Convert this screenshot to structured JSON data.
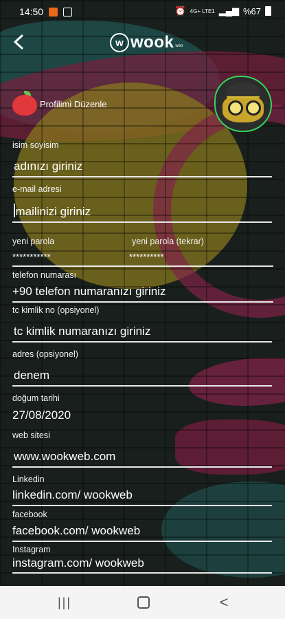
{
  "status_bar": {
    "time": "14:50",
    "battery": "%67",
    "network": "4G+ LTE1"
  },
  "header": {
    "back_icon": "chevron-left-icon",
    "logo_letter": "w",
    "logo_text": "wook",
    "logo_small": "web"
  },
  "profile": {
    "title": "Profilimi Düzenle"
  },
  "form": {
    "name": {
      "label": "isim soyisim",
      "value": "adınızı giriniz"
    },
    "email": {
      "label": "e-mail adresi",
      "value": "mailinizi giriniz"
    },
    "password": {
      "label": "yeni parola",
      "value": "***********"
    },
    "password_repeat": {
      "label": "yeni parola (tekrar)",
      "value": "**********"
    },
    "phone": {
      "label": "telefon numarası",
      "value": "+90 telefon numaranızı giriniz"
    },
    "tc": {
      "label": "tc kimlik no (opsiyonel)",
      "value": "tc kimlik numaranızı giriniz"
    },
    "address": {
      "label": "adres (opsiyonel)",
      "value": "denem"
    },
    "birthdate": {
      "label": "doğum tarihi",
      "value": "27/08/2020"
    },
    "website": {
      "label": "web sitesi",
      "value": "www.wookweb.com"
    },
    "linkedin": {
      "label": "Linkedin",
      "value": "linkedin.com/ wookweb"
    },
    "facebook": {
      "label": "facebook",
      "value": "facebook.com/ wookweb"
    },
    "instagram": {
      "label": "Instagram",
      "value": "instagram.com/ wookweb"
    }
  },
  "nav": {
    "recents": "|||",
    "back": "<"
  },
  "colors": {
    "accent": "#36d65a",
    "apple": "#e0383b",
    "navbar": "#f4f4f4"
  }
}
